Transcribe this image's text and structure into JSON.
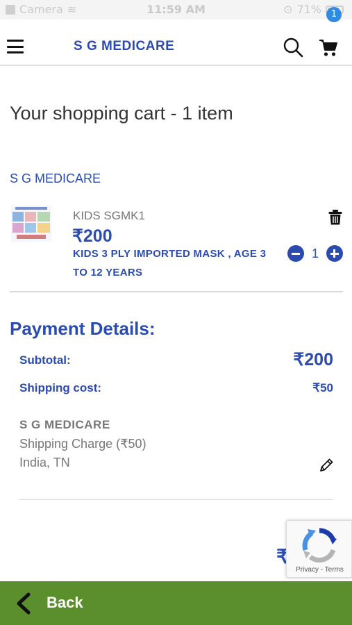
{
  "status_bar": {
    "carrier": "Camera",
    "time": "11:59 AM",
    "battery": "71%"
  },
  "header": {
    "brand": "S G MEDICARE",
    "cart_count": "1",
    "icons": [
      "menu-icon",
      "search-icon",
      "cart-icon"
    ]
  },
  "cart": {
    "title": "Your shopping cart - 1 item",
    "seller": "S G MEDICARE",
    "items": [
      {
        "name": "KIDS SGMK1",
        "price": "₹200",
        "description": "KIDS 3 PLY IMPORTED MASK , AGE 3 TO 12 YEARS",
        "quantity": "1"
      }
    ]
  },
  "payment": {
    "title": "Payment Details:",
    "subtotal_label": "Subtotal:",
    "subtotal_value": "₹200",
    "shipping_label": "Shipping cost:",
    "shipping_value": "₹50",
    "address": {
      "name": "S G MEDICARE",
      "line1": "Shipping Charge (₹50)",
      "line2": "India, TN"
    },
    "total_partial": "₹"
  },
  "recaptcha": {
    "text": "Privacy - Terms"
  },
  "footer": {
    "back_label": "Back"
  },
  "colors": {
    "accent": "#2a4cb0",
    "footer": "#5b8e2d",
    "badge": "#2e8be0"
  }
}
